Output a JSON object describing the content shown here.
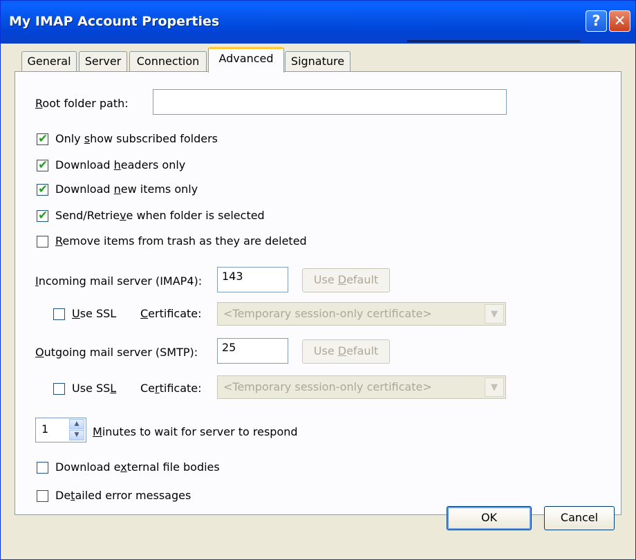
{
  "window": {
    "title": "My IMAP Account Properties",
    "help_glyph": "?",
    "close_glyph": "✕"
  },
  "tabs": [
    {
      "label": "General",
      "active": false
    },
    {
      "label": "Server",
      "active": false
    },
    {
      "label": "Connection",
      "active": false
    },
    {
      "label": "Advanced",
      "active": true
    },
    {
      "label": "Signature",
      "active": false
    }
  ],
  "root_folder": {
    "label_ul": "R",
    "label_rest": "oot folder path:",
    "value": ""
  },
  "options": {
    "subscribed": {
      "pre": "Only ",
      "ul": "s",
      "post": "how subscribed folders",
      "checked": true
    },
    "headers": {
      "pre": "Download ",
      "ul": "h",
      "post": "eaders only",
      "checked": true
    },
    "new_items": {
      "pre": "Download ",
      "ul": "n",
      "post": "ew items only",
      "checked": true
    },
    "send_retrieve": {
      "pre": "Send/Retrie",
      "ul": "v",
      "post": "e when folder is selected",
      "checked": true
    },
    "remove_trash": {
      "pre": "",
      "ul": "R",
      "post": "emove items from trash as they are deleted",
      "checked": false
    }
  },
  "incoming": {
    "label_ul": "I",
    "label_rest": "ncoming mail server (IMAP4):",
    "port": "143",
    "default_pre": "Use ",
    "default_ul": "D",
    "default_post": "efault",
    "ssl_pre": "",
    "ssl_ul": "U",
    "ssl_post": "se SSL",
    "ssl_checked": false,
    "cert_ul": "C",
    "cert_rest": "ertificate:",
    "cert_value": "<Temporary session-only certificate>"
  },
  "outgoing": {
    "label_ul": "O",
    "label_rest": "utgoing mail server (SMTP):",
    "port": "25",
    "default_pre": "Use ",
    "default_ul": "D",
    "default_post": "efault",
    "ssl_pre": "Use SS",
    "ssl_ul": "L",
    "ssl_post": "",
    "ssl_checked": false,
    "cert_pre": "Ce",
    "cert_ul": "r",
    "cert_post": "tificate:",
    "cert_value": "<Temporary session-only certificate>"
  },
  "timeout": {
    "value": "1",
    "label_ul": "M",
    "label_rest": "inutes to wait for server to respond"
  },
  "external": {
    "pre": "Download e",
    "ul": "x",
    "post": "ternal file bodies",
    "checked": false
  },
  "detailed": {
    "pre": "De",
    "ul": "t",
    "post": "ailed error messages",
    "checked": false
  },
  "buttons": {
    "ok": "OK",
    "cancel": "Cancel"
  },
  "colors": {
    "titlebar": "#0451e4",
    "dialog_bg": "#ece9d8",
    "check_tick": "#21a121",
    "active_tab_accent": "#ffc83c"
  },
  "icons": {
    "help": "help-icon",
    "close": "close-icon",
    "checkmark": "checkmark-icon",
    "dropdown": "chevron-down-icon",
    "spin_up": "spin-up-icon",
    "spin_down": "spin-down-icon"
  }
}
